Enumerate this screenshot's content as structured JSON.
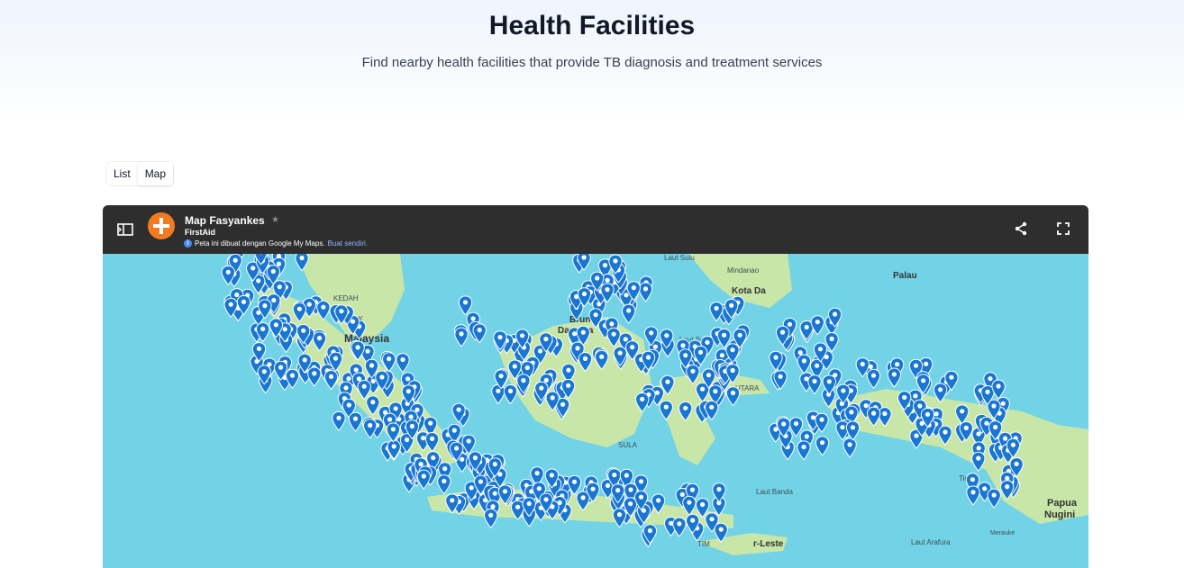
{
  "header": {
    "title": "Health Facilities",
    "subtitle": "Find nearby health facilities that provide TB diagnosis and treatment services"
  },
  "view_tabs": [
    {
      "label": "List",
      "active": false
    },
    {
      "label": "Map",
      "active": true
    }
  ],
  "map": {
    "name": "Map Fasyankes",
    "owner": "FirstAid",
    "info_text": "Peta ini dibuat dengan Google My Maps.",
    "info_link": "Buat sendiri.",
    "icons": {
      "panel": "side-panel-icon",
      "share": "share-icon",
      "fullscreen": "fullscreen-icon",
      "star": "star-icon",
      "marker": "location-pin-icon"
    },
    "colors": {
      "sea": "#72d3e6",
      "land": "#c8e6a8",
      "marker": "#1976d2",
      "toolbar": "#2e2e2e",
      "logo": "#f47a20"
    },
    "labels": {
      "laut_sulu": "Laut Sulu",
      "mindanao": "Mindanao",
      "palau": "Palau",
      "kota_da": "Kota Da",
      "kedah": "KEDAH",
      "perak": "PERAK",
      "malaysia": "Malaysia",
      "brunei": "Brun",
      "darussalam": "Darussa",
      "laut_sulawesi": "Laut Sulawesi",
      "utara": "UTARA",
      "sulawesi": "SULA",
      "laut_banda": "Laut Banda",
      "timika": "Timika",
      "papua": "Papua",
      "nugini": "Nugini",
      "timor_leste": "r-Leste",
      "timur": "TIM",
      "laut_arafura": "Laut Arafura",
      "merauke": "Merauke"
    }
  }
}
